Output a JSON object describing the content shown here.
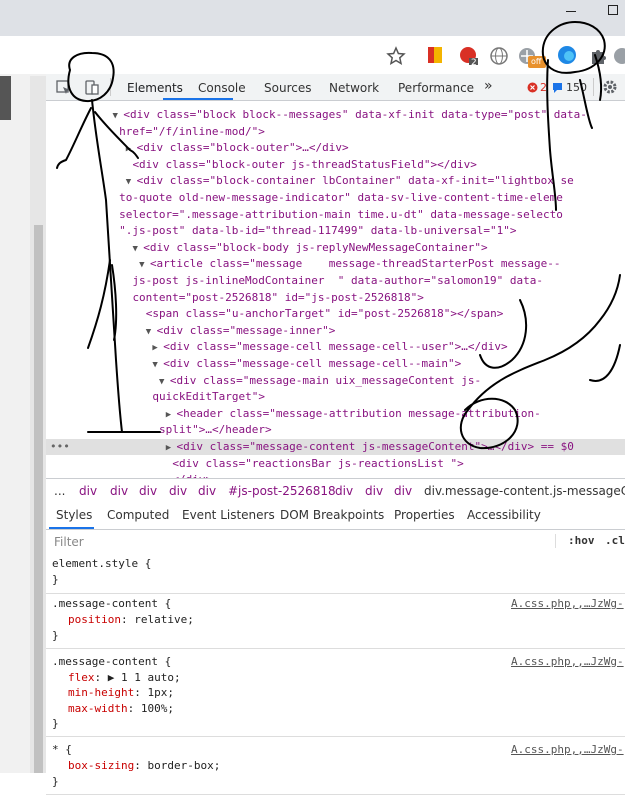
{
  "browser": {
    "extension_badge_1": "2",
    "extension_badge_2": "off"
  },
  "devtools": {
    "tabs": [
      "Elements",
      "Console",
      "Sources",
      "Network",
      "Performance"
    ],
    "more_tabs": "»",
    "error_count": "2",
    "message_count": "150",
    "elements_lines": [
      {
        "indent": 10,
        "tri": "▼",
        "html": "<div class=\"block block--messages\" data-xf-init data-type=\"post\" data-"
      },
      {
        "indent": 11,
        "tri": "",
        "html": "href=\"/f/inline-mod/\">"
      },
      {
        "indent": 12,
        "tri": "▶",
        "html": "<div class=\"block-outer\">…</div>"
      },
      {
        "indent": 13,
        "tri": "",
        "html": "<div class=\"block-outer js-threadStatusField\"></div>"
      },
      {
        "indent": 12,
        "tri": "▼",
        "html": "<div class=\"block-container lbContainer\" data-xf-init=\"lightbox se"
      },
      {
        "indent": 11,
        "tri": "",
        "html": "to-quote old-new-message-indicator\" data-sv-live-content-time-eleme"
      },
      {
        "indent": 11,
        "tri": "",
        "html": "selector=\".message-attribution-main time.u-dt\" data-message-selecto"
      },
      {
        "indent": 11,
        "tri": "",
        "html": "\".js-post\" data-lb-id=\"thread-117499\" data-lb-universal=\"1\">"
      },
      {
        "indent": 13,
        "tri": "▼",
        "html": "<div class=\"block-body js-replyNewMessageContainer\">"
      },
      {
        "indent": 14,
        "tri": "▼",
        "html": "<article class=\"message    message-threadStarterPost message--"
      },
      {
        "indent": 13,
        "tri": "",
        "html": "js-post js-inlineModContainer  \" data-author=\"salomon19\" data-"
      },
      {
        "indent": 13,
        "tri": "",
        "html": "content=\"post-2526818\" id=\"js-post-2526818\">"
      },
      {
        "indent": 15,
        "tri": "",
        "html": "<span class=\"u-anchorTarget\" id=\"post-2526818\"></span>"
      },
      {
        "indent": 15,
        "tri": "▼",
        "html": "<div class=\"message-inner\">"
      },
      {
        "indent": 16,
        "tri": "▶",
        "html": "<div class=\"message-cell message-cell--user\">…</div>"
      },
      {
        "indent": 16,
        "tri": "▼",
        "html": "<div class=\"message-cell message-cell--main\">"
      },
      {
        "indent": 17,
        "tri": "▼",
        "html": "<div class=\"message-main uix_messageContent js-"
      },
      {
        "indent": 16,
        "tri": "",
        "html": "quickEditTarget\">"
      },
      {
        "indent": 18,
        "tri": "▶",
        "html": "<header class=\"message-attribution message-attribution-"
      },
      {
        "indent": 17,
        "tri": "",
        "html": "split\">…</header>"
      },
      {
        "indent": 18,
        "tri": "▶",
        "html": "<div class=\"message-content js-messageContent\">…</div> == $0"
      },
      {
        "indent": 19,
        "tri": "",
        "html": "<div class=\"reactionsBar js-reactionsList \">"
      },
      {
        "indent": 19,
        "tri": "",
        "html": "</div>"
      }
    ],
    "selected_marker": "•••",
    "breadcrumbs": [
      "...",
      "div",
      "div",
      "div",
      "div",
      "div",
      "#js-post-2526818",
      "div",
      "div",
      "div",
      "div.message-content.js-messageConte"
    ],
    "subtabs": [
      "Styles",
      "Computed",
      "Event Listeners",
      "DOM Breakpoints",
      "Properties",
      "Accessibility"
    ],
    "filter_placeholder": "Filter",
    "hov_label": ":hov",
    "cls_label": ".cl",
    "styles": {
      "element_style": {
        "selector": "element.style {",
        "close": "}"
      },
      "rules": [
        {
          "selector": ".message-content {",
          "source": "A.css.php,,…JzWg-",
          "props": [
            {
              "name": "position",
              "value": "relative;"
            }
          ],
          "close": "}"
        },
        {
          "selector": ".message-content {",
          "source": "A.css.php,,…JzWg-",
          "props": [
            {
              "name": "flex",
              "value": "▶ 1 1 auto;"
            },
            {
              "name": "min-height",
              "value": "1px;"
            },
            {
              "name": "max-width",
              "value": "100%;"
            }
          ],
          "close": "}"
        },
        {
          "selector": "* {",
          "source": "A.css.php,,…JzWg-",
          "props": [
            {
              "name": "box-sizing",
              "value": "border-box;"
            }
          ],
          "close": "}"
        }
      ]
    }
  },
  "colors": {
    "accent": "#1a73e8",
    "tag": "#881280",
    "attr_name": "#994500",
    "attr_value": "#1a1aa6"
  }
}
